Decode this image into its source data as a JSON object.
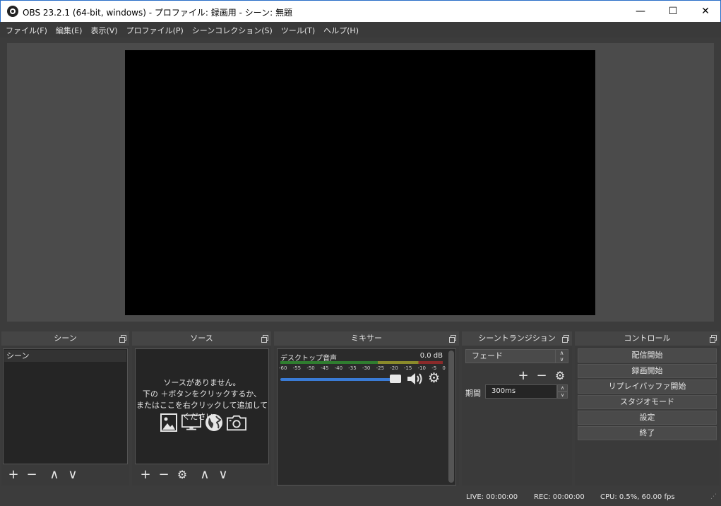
{
  "window": {
    "title": "OBS 23.2.1 (64-bit, windows) - プロファイル: 録画用 - シーン: 無題",
    "minimize": "—",
    "maximize": "☐",
    "close": "✕"
  },
  "menu": [
    "ファイル(F)",
    "編集(E)",
    "表示(V)",
    "プロファイル(P)",
    "シーンコレクション(S)",
    "ツール(T)",
    "ヘルプ(H)"
  ],
  "docks": {
    "scenes": {
      "title": "シーン",
      "items": [
        "シーン"
      ],
      "tools": [
        "+",
        "−",
        "∧",
        "∨"
      ]
    },
    "sources": {
      "title": "ソース",
      "empty_line1": "ソースがありません。",
      "empty_line2": "下の ＋ボタンをクリックするか、",
      "empty_line3": "またはここを右クリックして追加してください。",
      "icons": [
        "image-icon",
        "monitor-icon",
        "globe-icon",
        "camera-icon"
      ],
      "tools": [
        "+",
        "−",
        "⚙",
        "∧",
        "∨"
      ]
    },
    "mixer": {
      "title": "ミキサー",
      "channel": "デスクトップ音声",
      "db": "0.0 dB",
      "scale": [
        "-60",
        "-55",
        "-50",
        "-45",
        "-40",
        "-35",
        "-30",
        "-25",
        "-20",
        "-15",
        "-10",
        "-5",
        "0"
      ],
      "volume_level": 1.0
    },
    "transitions": {
      "title": "シーントランジション",
      "selected": "フェード",
      "duration_label": "期間",
      "duration_value": "300ms"
    },
    "controls": {
      "title": "コントロール",
      "buttons": [
        "配信開始",
        "録画開始",
        "リプレイバッファ開始",
        "スタジオモード",
        "設定",
        "終了"
      ]
    }
  },
  "status": {
    "live": "LIVE: 00:00:00",
    "rec": "REC: 00:00:00",
    "cpu": "CPU: 0.5%, 60.00 fps"
  }
}
